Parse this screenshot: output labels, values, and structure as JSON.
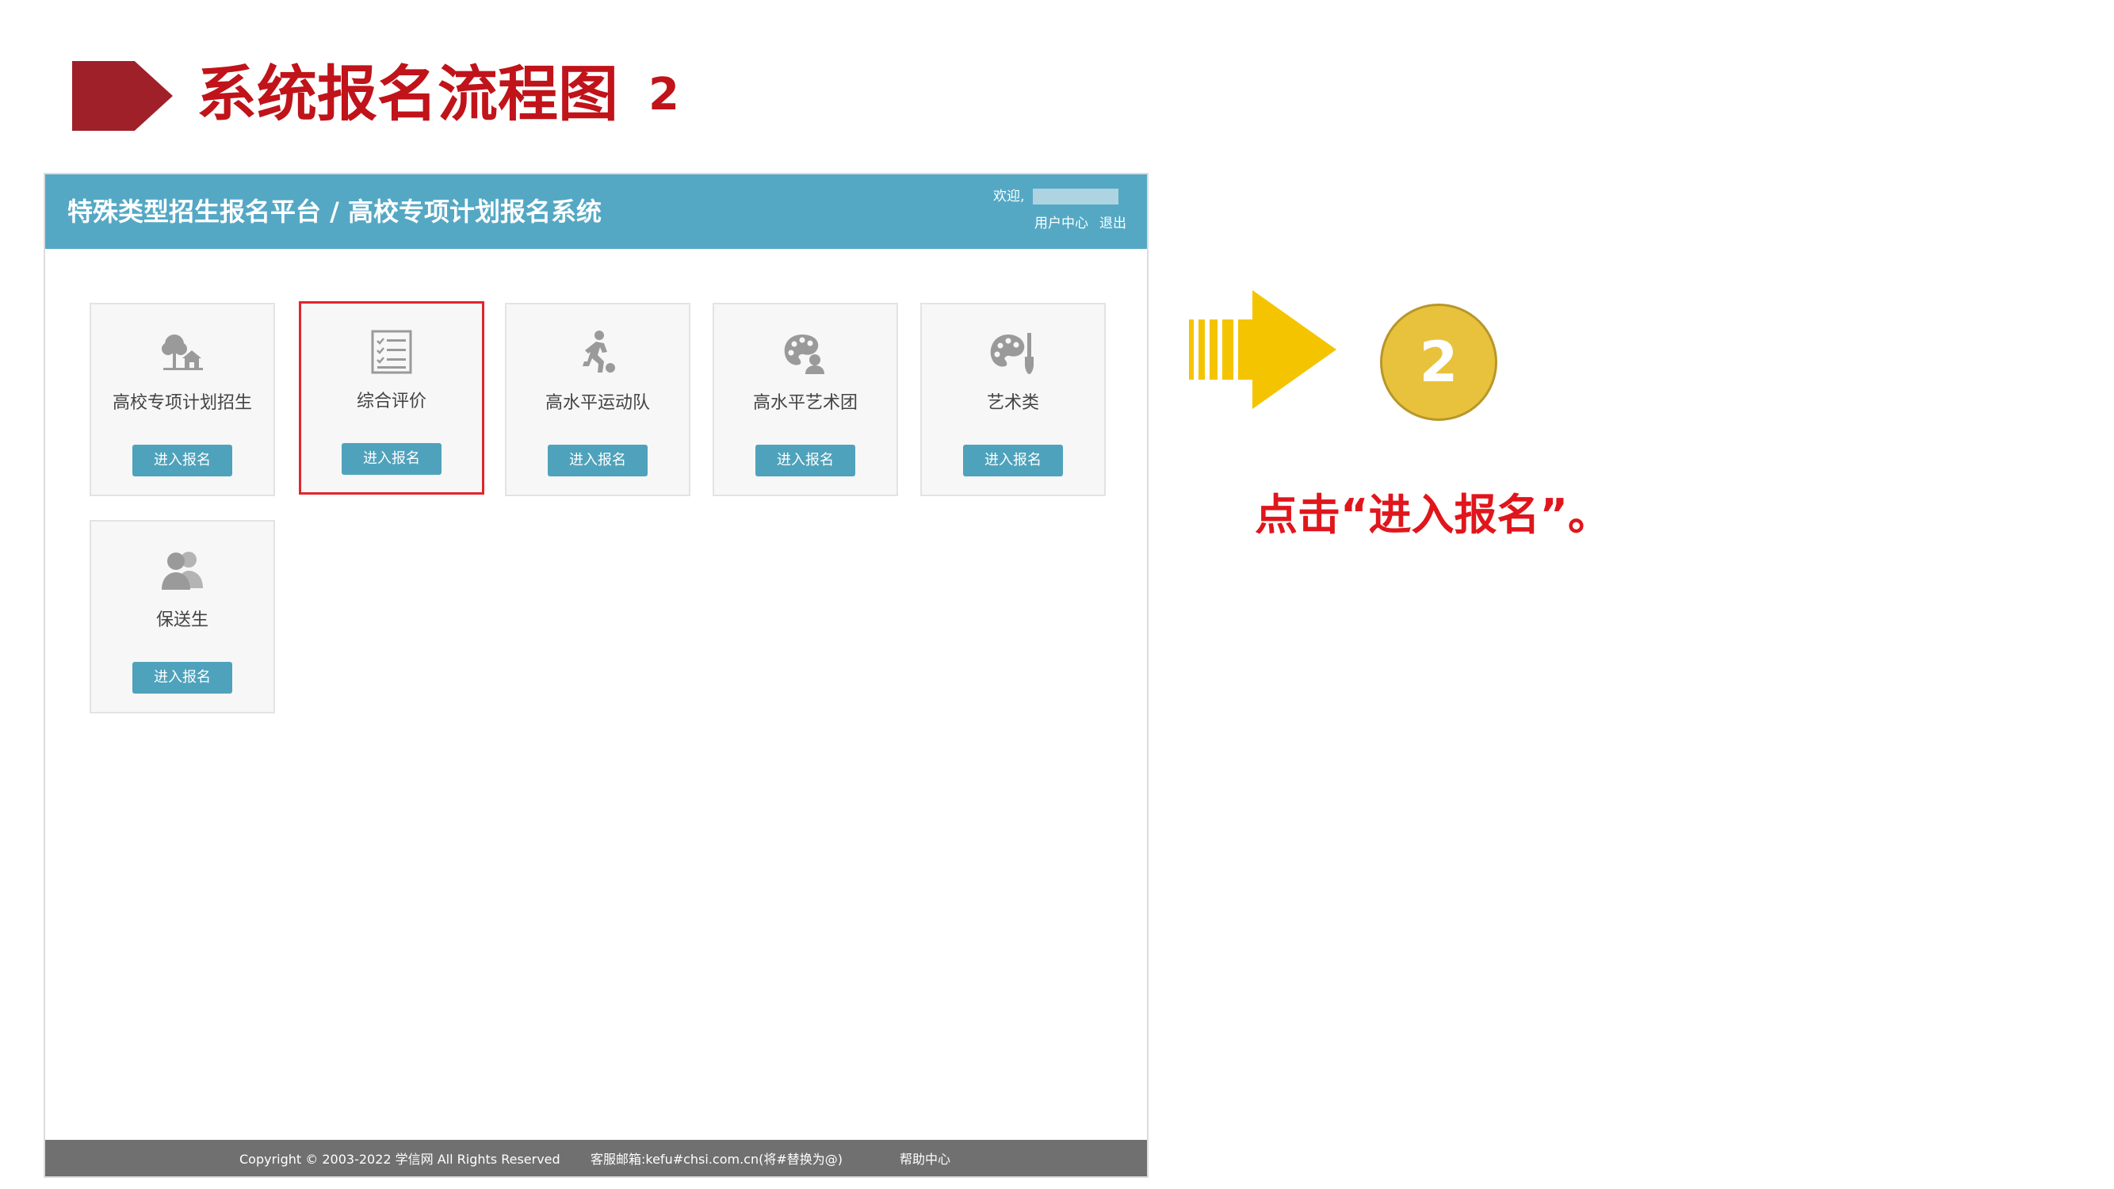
{
  "slide": {
    "title": "系统报名流程图",
    "title_number": "2",
    "step_number": "2",
    "instruction": "点击“进入报名”。"
  },
  "app": {
    "title": "特殊类型招生报名平台 / 高校专项计划报名系统",
    "welcome": "欢迎,",
    "user_center": "用户中心",
    "logout": "退出"
  },
  "cards": [
    {
      "label": "高校专项计划招生",
      "button": "进入报名",
      "icon": "tree-house-icon"
    },
    {
      "label": "综合评价",
      "button": "进入报名",
      "icon": "checklist-icon"
    },
    {
      "label": "高水平运动队",
      "button": "进入报名",
      "icon": "runner-icon"
    },
    {
      "label": "高水平艺术团",
      "button": "进入报名",
      "icon": "palette-person-icon"
    },
    {
      "label": "艺术类",
      "button": "进入报名",
      "icon": "palette-brush-icon"
    },
    {
      "label": "保送生",
      "button": "进入报名",
      "icon": "users-icon"
    }
  ],
  "footer": {
    "copyright": "Copyright © 2003-2022 学信网 All Rights Reserved",
    "email": "客服邮箱:kefu#chsi.com.cn(将#替换为@)",
    "help": "帮助中心"
  },
  "colors": {
    "title_red": "#c0131a",
    "header_blue": "#54a8c4",
    "button_blue": "#4fa2bb",
    "selected_border": "#e0262c",
    "arrow_yellow": "#f5c400",
    "step_circle": "#e8c23c"
  }
}
